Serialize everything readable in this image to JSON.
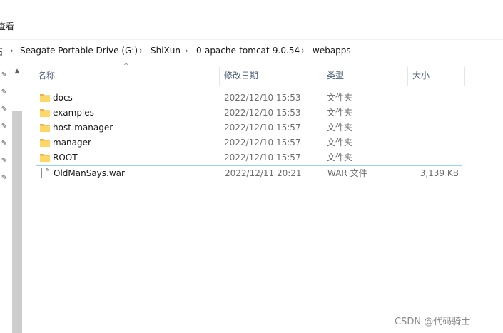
{
  "ribbon": {
    "tab_view": "查看"
  },
  "breadcrumb": {
    "items": [
      "Seagate Portable Drive (G:)",
      "ShiXun",
      "0-apache-tomcat-9.0.54",
      "webapps"
    ],
    "separator": "›",
    "left_fragment": "石"
  },
  "columns": {
    "name": "名称",
    "date": "修改日期",
    "type": "类型",
    "size": "大小"
  },
  "files": [
    {
      "name": "docs",
      "date": "2022/12/10 15:53",
      "type": "文件夹",
      "size": "",
      "icon": "folder-icon"
    },
    {
      "name": "examples",
      "date": "2022/12/10 15:53",
      "type": "文件夹",
      "size": "",
      "icon": "folder-icon"
    },
    {
      "name": "host-manager",
      "date": "2022/12/10 15:57",
      "type": "文件夹",
      "size": "",
      "icon": "folder-icon"
    },
    {
      "name": "manager",
      "date": "2022/12/10 15:57",
      "type": "文件夹",
      "size": "",
      "icon": "folder-icon"
    },
    {
      "name": "ROOT",
      "date": "2022/12/10 15:57",
      "type": "文件夹",
      "size": "",
      "icon": "folder-icon"
    },
    {
      "name": "OldManSays.war",
      "date": "2022/12/11 20:21",
      "type": "WAR 文件",
      "size": "3,139 KB",
      "icon": "file-icon"
    }
  ],
  "watermark": "CSDN @代码骑士",
  "colors": {
    "folder": "#ffd766",
    "folder_dark": "#e8b44a",
    "selection_border": "#99d1ff",
    "header_text": "#4c607a"
  }
}
